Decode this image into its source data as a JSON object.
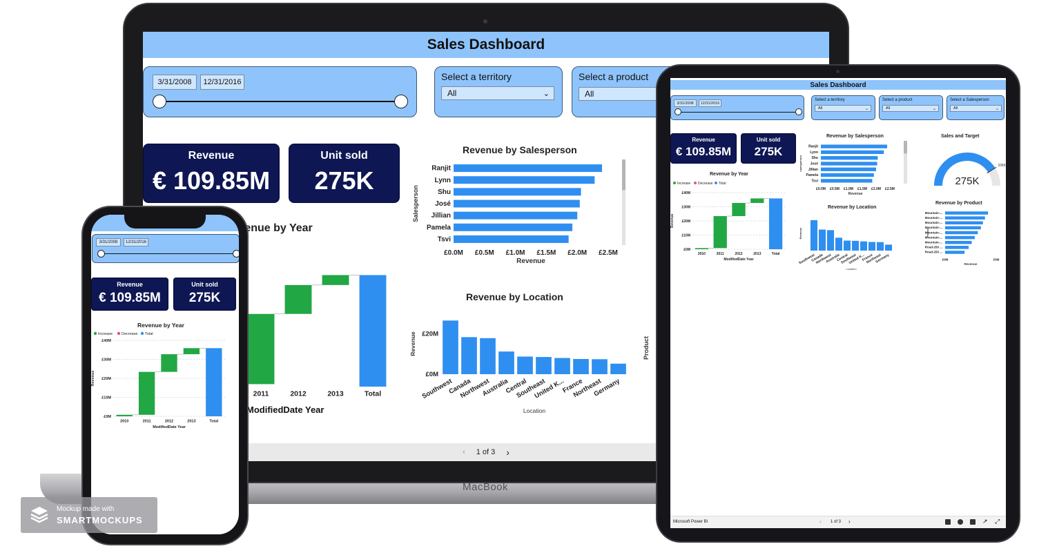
{
  "app": {
    "title": "Sales Dashboard",
    "device_brand": "MacBook",
    "watermark_line1": "Mockup made with",
    "watermark_line2": "SMARTMOCKUPS",
    "tablet_footer_brand": "Microsoft Power BI"
  },
  "filters": {
    "date_start": "3/31/2008",
    "date_end": "12/31/2016",
    "territory_label": "Select a territory",
    "territory_value": "All",
    "product_label": "Select a product",
    "product_value": "All",
    "salesperson_label": "Select a Salesperson",
    "salesperson_value": "All"
  },
  "kpis": {
    "revenue_label": "Revenue",
    "revenue_value": "€ 109.85M",
    "units_label": "Unit sold",
    "units_value": "275K"
  },
  "pagination": {
    "label": "1 of 3"
  },
  "gauge": {
    "title": "Sales and Target",
    "value": "275K",
    "target": "336K",
    "fraction": 0.82
  },
  "colors": {
    "header": "#8ec4fb",
    "kpi_bg": "#0e1753",
    "bar": "#2f8ff0",
    "increase": "#22a745",
    "decrease": "#e0567a",
    "total": "#2f8ff0"
  },
  "icons": [
    "chevron-down-icon",
    "chevron-left-icon",
    "chevron-right-icon",
    "linkedin-icon",
    "twitter-icon",
    "facebook-icon",
    "share-icon",
    "expand-icon",
    "stack-logo-icon"
  ],
  "chart_data": [
    {
      "id": "salesperson",
      "type": "bar",
      "orientation": "horizontal",
      "title": "Revenue by Salesperson",
      "ylabel": "Salesperson",
      "xlabel": "Revenue",
      "categories": [
        "Ranjit",
        "Lynn",
        "Shu",
        "José",
        "Jillian",
        "Pamela",
        "Tsvi"
      ],
      "values": [
        2.4,
        2.28,
        2.06,
        2.04,
        2.0,
        1.92,
        1.86
      ],
      "xticks": [
        "£0.0M",
        "£0.5M",
        "£1.0M",
        "£1.5M",
        "£2.0M",
        "£2.5M"
      ],
      "xlim": [
        0,
        2.5
      ]
    },
    {
      "id": "year",
      "type": "waterfall",
      "title": "Revenue by Year",
      "xlabel": "ModifiedDate Year",
      "ylabel": "Revenue",
      "legend": [
        "Increase",
        "Decrease",
        "Total"
      ],
      "categories": [
        "2010",
        "2011",
        "2012",
        "2013",
        "Total"
      ],
      "values": [
        0.8,
        22.6,
        9.3,
        3.2,
        35.9
      ],
      "yticks": [
        "£0M",
        "£10M",
        "£20M",
        "£30M",
        "£40M"
      ],
      "ylim": [
        0,
        40
      ]
    },
    {
      "id": "location",
      "type": "bar",
      "title": "Revenue by Location",
      "xlabel": "Location",
      "ylabel": "Revenue",
      "categories": [
        "Southwest",
        "Canada",
        "Northwest",
        "Australia",
        "Central",
        "Southeast",
        "United K...",
        "France",
        "Northeast",
        "Germany"
      ],
      "values": [
        26.5,
        18.3,
        17.8,
        11.2,
        8.7,
        8.5,
        8.0,
        7.5,
        7.4,
        5.2
      ],
      "yticks": [
        "£0M",
        "£20M"
      ],
      "ylim": [
        0,
        30
      ]
    },
    {
      "id": "product",
      "type": "bar",
      "orientation": "horizontal",
      "title": "Revenue by Product",
      "ylabel": "Product",
      "xlabel": "Revenue",
      "categories": [
        "Mountain-...",
        "Mountain-...",
        "Mountain-...",
        "Mountain-...",
        "Mountain-...",
        "Mountain-...",
        "Mountain-...",
        "Road-250 ...",
        "Road-250 ..."
      ],
      "values": [
        4.2,
        3.9,
        3.7,
        3.5,
        3.2,
        2.9,
        2.6,
        2.3,
        1.9
      ],
      "xticks": [
        "£0M",
        "£5M"
      ],
      "xlim": [
        0,
        5
      ]
    }
  ]
}
